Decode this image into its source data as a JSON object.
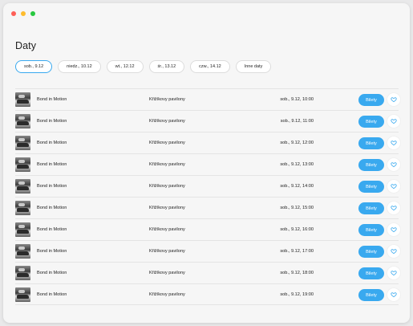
{
  "page": {
    "title": "Daty"
  },
  "date_filters": [
    {
      "label": "sob., 9.12",
      "active": true
    },
    {
      "label": "niedz., 10.12",
      "active": false
    },
    {
      "label": "wt., 12.12",
      "active": false
    },
    {
      "label": "śr., 13.12",
      "active": false
    },
    {
      "label": "czw., 14.12",
      "active": false
    },
    {
      "label": "Inne daty",
      "active": false
    }
  ],
  "events": [
    {
      "name": "Bond in Motion",
      "venue": "Křižíkovy pavilony",
      "datetime": "sob., 9.12, 10:00",
      "button": "Bilety"
    },
    {
      "name": "Bond in Motion",
      "venue": "Křižíkovy pavilony",
      "datetime": "sob., 9.12, 11:00",
      "button": "Bilety"
    },
    {
      "name": "Bond in Motion",
      "venue": "Křižíkovy pavilony",
      "datetime": "sob., 9.12, 12:00",
      "button": "Bilety"
    },
    {
      "name": "Bond in Motion",
      "venue": "Křižíkovy pavilony",
      "datetime": "sob., 9.12, 13:00",
      "button": "Bilety"
    },
    {
      "name": "Bond in Motion",
      "venue": "Křižíkovy pavilony",
      "datetime": "sob., 9.12, 14:00",
      "button": "Bilety"
    },
    {
      "name": "Bond in Motion",
      "venue": "Křižíkovy pavilony",
      "datetime": "sob., 9.12, 15:00",
      "button": "Bilety"
    },
    {
      "name": "Bond in Motion",
      "venue": "Křižíkovy pavilony",
      "datetime": "sob., 9.12, 16:00",
      "button": "Bilety"
    },
    {
      "name": "Bond in Motion",
      "venue": "Křižíkovy pavilony",
      "datetime": "sob., 9.12, 17:00",
      "button": "Bilety"
    },
    {
      "name": "Bond in Motion",
      "venue": "Křižíkovy pavilony",
      "datetime": "sob., 9.12, 18:00",
      "button": "Bilety"
    },
    {
      "name": "Bond in Motion",
      "venue": "Křižíkovy pavilony",
      "datetime": "sob., 9.12, 19:00",
      "button": "Bilety"
    }
  ],
  "icons": {
    "favorite": "heart-outline-icon",
    "thumbnail": "event-thumbnail"
  },
  "colors": {
    "accent": "#39a9ef",
    "background": "#f6f6f6",
    "text": "#222222"
  }
}
